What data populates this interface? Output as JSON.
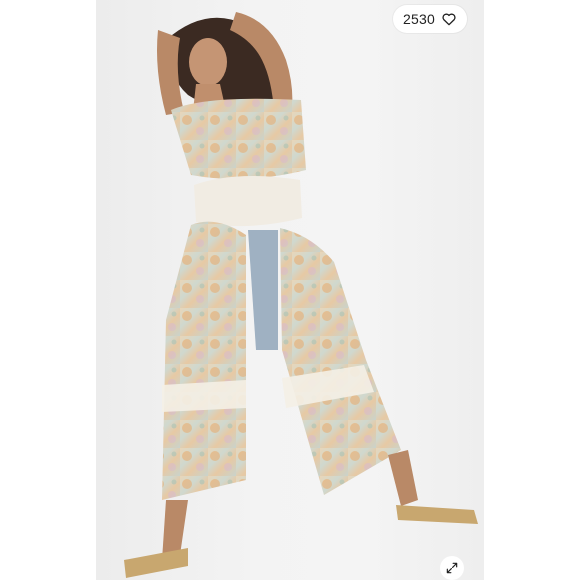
{
  "listing": {
    "like_count": "2530",
    "icons": {
      "like": "heart-icon",
      "expand": "expand-arrows-icon"
    }
  },
  "colors": {
    "background": "#ffffff",
    "photo_backdrop": "#f0f0f0",
    "badge_bg": "#ffffff",
    "badge_text": "#222222"
  }
}
